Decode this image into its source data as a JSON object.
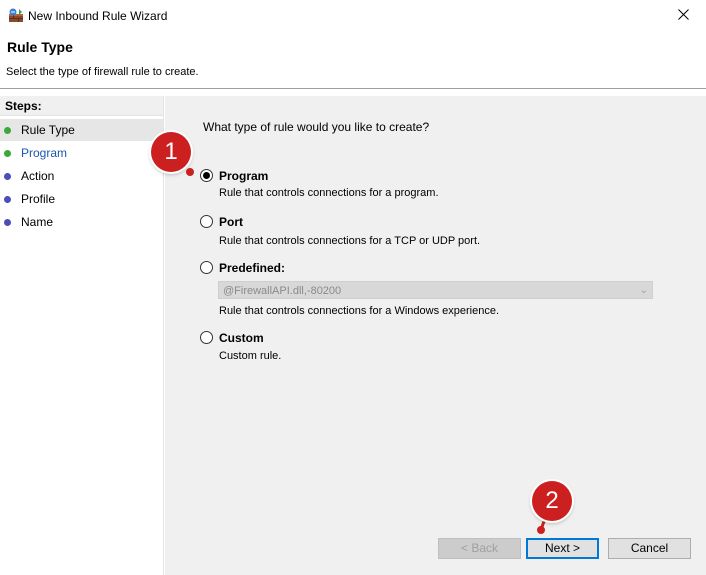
{
  "window": {
    "title": "New Inbound Rule Wizard"
  },
  "header": {
    "title": "Rule Type",
    "subtitle": "Select the type of firewall rule to create."
  },
  "sidebar": {
    "steps_label": "Steps:",
    "steps": [
      {
        "label": "Rule Type",
        "dot_color": "#3aa83a",
        "label_color": "#000000"
      },
      {
        "label": "Program",
        "dot_color": "#3aa83a",
        "label_color": "#1a56b0"
      },
      {
        "label": "Action",
        "dot_color": "#4a4fb8",
        "label_color": "#000000"
      },
      {
        "label": "Profile",
        "dot_color": "#4a4fb8",
        "label_color": "#000000"
      },
      {
        "label": "Name",
        "dot_color": "#4a4fb8",
        "label_color": "#000000"
      }
    ]
  },
  "main": {
    "question": "What type of rule would you like to create?",
    "options": [
      {
        "label": "Program",
        "description": "Rule that controls connections for a program.",
        "selected": true
      },
      {
        "label": "Port",
        "description": "Rule that controls connections for a TCP or UDP port.",
        "selected": false
      },
      {
        "label": "Predefined:",
        "description": "Rule that controls connections for a Windows experience.",
        "selected": false
      },
      {
        "label": "Custom",
        "description": "Custom rule.",
        "selected": false
      }
    ],
    "predefined_combo_value": "@FirewallAPI.dll,-80200"
  },
  "buttons": {
    "back": "< Back",
    "next": "Next >",
    "cancel": "Cancel"
  },
  "annotations": {
    "badge1": "1",
    "badge2": "2"
  },
  "colors": {
    "annotation": "#cc1f1f",
    "focus": "#0078d7"
  }
}
